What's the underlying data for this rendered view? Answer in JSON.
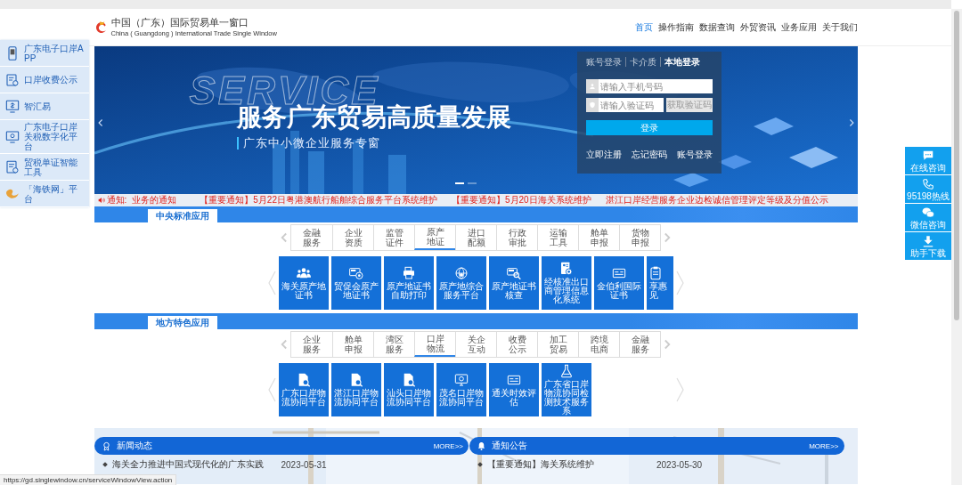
{
  "header": {
    "logo_title": "中国（广东）国际贸易单一窗口",
    "logo_subtitle": "China ( Guangdong ) International Trade Single Window",
    "nav": [
      {
        "label": "首页",
        "selected": true
      },
      {
        "label": "操作指南",
        "selected": false
      },
      {
        "label": "数据查询",
        "selected": false
      },
      {
        "label": "外贸资讯",
        "selected": false
      },
      {
        "label": "业务应用",
        "selected": false
      },
      {
        "label": "关于我们",
        "selected": false
      }
    ]
  },
  "banner": {
    "watermark_word": "SERVICE",
    "headline": "服务广东贸易高质量发展",
    "subheadline": "广东中小微企业服务专窗",
    "login": {
      "tabs": [
        {
          "label": "账号登录",
          "selected": false
        },
        {
          "label": "卡介质",
          "selected": false
        },
        {
          "label": "本地登录",
          "selected": true
        }
      ],
      "phone_placeholder": "请输入手机号码",
      "code_placeholder": "请输入验证码",
      "code_button": "获取验证码",
      "submit": "登录",
      "links": [
        "立即注册",
        "忘记密码",
        "账号登录"
      ]
    },
    "slides": [
      {
        "selected": true
      },
      {
        "selected": false
      }
    ]
  },
  "notice": {
    "label": "通知:",
    "items": [
      "业务的通知",
      "【重要通知】5月22日粤港澳航行船舶综合服务平台系统维护",
      "【重要通知】5月20日海关系统维护",
      "湛江口岸经营服务企业边检诚信管理评定等级及分值公示"
    ]
  },
  "sections": [
    {
      "title": "中央标准应用",
      "categories": [
        {
          "label": "金融服务",
          "selected": false
        },
        {
          "label": "企业资质",
          "selected": false
        },
        {
          "label": "监管证件",
          "selected": false
        },
        {
          "label": "原产地证",
          "selected": true
        },
        {
          "label": "进口配额",
          "selected": false
        },
        {
          "label": "行政审批",
          "selected": false
        },
        {
          "label": "运输工具",
          "selected": false
        },
        {
          "label": "舱单申报",
          "selected": false
        },
        {
          "label": "货物申报",
          "selected": false
        }
      ],
      "tiles": [
        {
          "kind": "app",
          "label": "海关原产地证书"
        },
        {
          "kind": "app",
          "label": "贸促会原产地证书"
        },
        {
          "kind": "app",
          "label": "原产地证书自助打印"
        },
        {
          "kind": "app",
          "label": "原产地综合服务平台"
        },
        {
          "kind": "app",
          "label": "原产地证书核查"
        },
        {
          "kind": "app",
          "label": "经核准出口商管理信息化系统"
        },
        {
          "kind": "app",
          "label": "金伯利国际证书"
        },
        {
          "kind": "cut",
          "label": "享惠见"
        }
      ]
    },
    {
      "title": "地方特色应用",
      "categories": [
        {
          "label": "企业服务",
          "selected": false
        },
        {
          "label": "舱单申报",
          "selected": false
        },
        {
          "label": "湾区服务",
          "selected": false
        },
        {
          "label": "口岸物流",
          "selected": true
        },
        {
          "label": "关企互动",
          "selected": false
        },
        {
          "label": "收费公示",
          "selected": false
        },
        {
          "label": "加工贸易",
          "selected": false
        },
        {
          "label": "跨境电商",
          "selected": false
        },
        {
          "label": "金融服务",
          "selected": false
        }
      ],
      "tiles": [
        {
          "kind": "app",
          "label": "广东口岸物流协同平台"
        },
        {
          "kind": "app",
          "label": "湛江口岸物流协同平台"
        },
        {
          "kind": "app",
          "label": "汕头口岸物流协同平台"
        },
        {
          "kind": "app",
          "label": "茂名口岸物流协同平台"
        },
        {
          "kind": "app",
          "label": "通关时效评估"
        },
        {
          "kind": "app",
          "label": "广东省口岸物流协同检测技术服务系"
        }
      ]
    }
  ],
  "news": [
    {
      "title": "新闻动态",
      "more": "MORE>>",
      "items": [
        {
          "text": "海关全力推进中国式现代化的广东实践",
          "date": "2023-05-31"
        }
      ]
    },
    {
      "title": "通知公告",
      "more": "MORE>>",
      "items": [
        {
          "text": "【重要通知】海关系统维护",
          "date": "2023-05-30"
        }
      ]
    }
  ],
  "left_sidebar": {
    "items": [
      {
        "label": "广东电子口岸APP"
      },
      {
        "label": "口岸收费公示"
      },
      {
        "label": "智汇易"
      },
      {
        "label": "广东电子口岸关税数字化平台"
      },
      {
        "label": "贸税单证智能工具"
      },
      {
        "label": "「海铁网」平台"
      }
    ]
  },
  "right_panel": {
    "items": [
      {
        "label": "在线咨询"
      },
      {
        "label": "95198热线"
      },
      {
        "label": "微信咨询"
      },
      {
        "label": "助手下载"
      }
    ]
  },
  "status_bar": {
    "url": "https://gd.singlewindow.cn/serviceWindowView.action"
  }
}
